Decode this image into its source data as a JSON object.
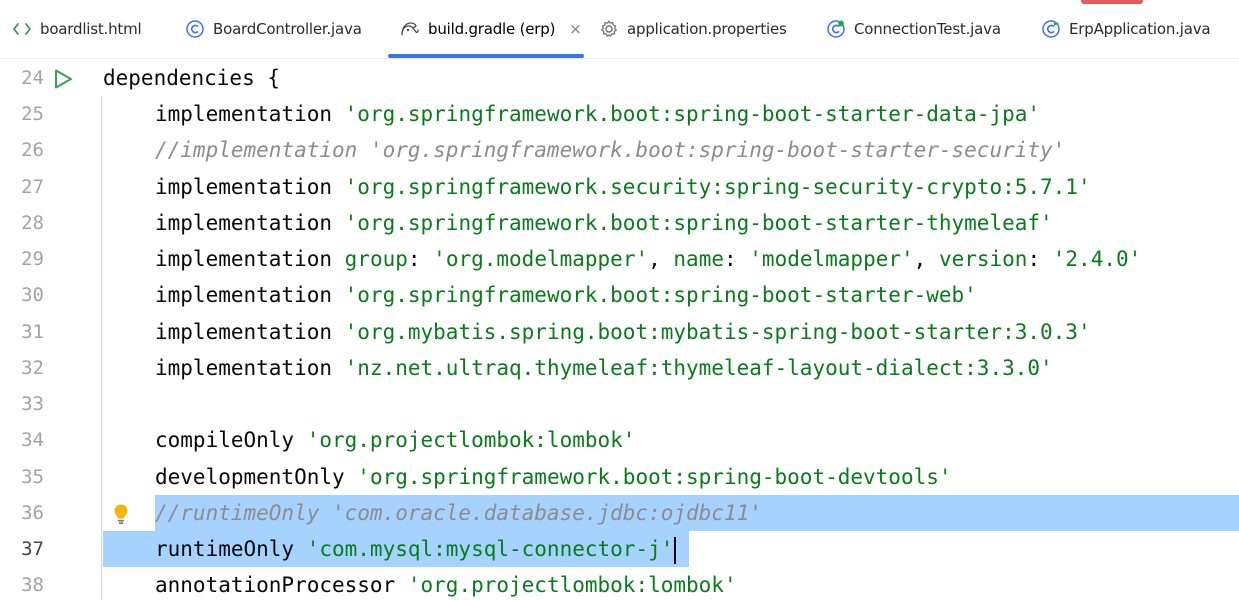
{
  "tabs": [
    {
      "label": "boardlist.html",
      "icon": "html-icon"
    },
    {
      "label": "BoardController.java",
      "icon": "java-class-icon"
    },
    {
      "label": "build.gradle (erp)",
      "icon": "gradle-icon",
      "active": true
    },
    {
      "label": "application.properties",
      "icon": "gear-icon"
    },
    {
      "label": "ConnectionTest.java",
      "icon": "java-test-icon"
    },
    {
      "label": "ErpApplication.java",
      "icon": "java-app-icon"
    }
  ],
  "tab_close_glyph": "×",
  "colors": {
    "accent": "#3574f0",
    "selection": "#a6d2ff",
    "string": "#067d17",
    "comment": "#8c8c8c",
    "run": "#2fa84f",
    "bulb": "#f2b705"
  },
  "editor": {
    "lines": [
      {
        "num": "24",
        "keyword": "dependencies {",
        "string": "",
        "comment": ""
      },
      {
        "num": "25",
        "keyword": "implementation ",
        "string": "'org.springframework.boot:spring-boot-starter-data-jpa'",
        "comment": ""
      },
      {
        "num": "26",
        "keyword": "",
        "string": "",
        "comment": "//implementation 'org.springframework.boot:spring-boot-starter-security'"
      },
      {
        "num": "27",
        "keyword": "implementation ",
        "string": "'org.springframework.security:spring-security-crypto:5.7.1'",
        "comment": ""
      },
      {
        "num": "28",
        "keyword": "implementation ",
        "string": "'org.springframework.boot:spring-boot-starter-thymeleaf'",
        "comment": ""
      },
      {
        "num": "29",
        "keyword": "implementation ",
        "group_label": "group",
        "group_value": "'org.modelmapper'",
        "name_label": "name",
        "name_value": "'modelmapper'",
        "version_label": "version",
        "version_value": "'2.4.0'"
      },
      {
        "num": "30",
        "keyword": "implementation ",
        "string": "'org.springframework.boot:spring-boot-starter-web'",
        "comment": ""
      },
      {
        "num": "31",
        "keyword": "implementation ",
        "string": "'org.mybatis.spring.boot:mybatis-spring-boot-starter:3.0.3'",
        "comment": ""
      },
      {
        "num": "32",
        "keyword": "implementation ",
        "string": "'nz.net.ultraq.thymeleaf:thymeleaf-layout-dialect:3.3.0'",
        "comment": ""
      },
      {
        "num": "33",
        "keyword": "",
        "string": "",
        "comment": ""
      },
      {
        "num": "34",
        "keyword": "compileOnly ",
        "string": "'org.projectlombok:lombok'",
        "comment": ""
      },
      {
        "num": "35",
        "keyword": "developmentOnly ",
        "string": "'org.springframework.boot:spring-boot-devtools'",
        "comment": ""
      },
      {
        "num": "36",
        "keyword": "",
        "string": "",
        "comment": "//runtimeOnly 'com.oracle.database.jdbc:ojdbc11'"
      },
      {
        "num": "37",
        "keyword": "runtimeOnly ",
        "string": "'com.mysql:mysql-connector-j'",
        "comment": ""
      },
      {
        "num": "38",
        "keyword": "annotationProcessor ",
        "string": "'org.projectlombok:lombok'",
        "comment": ""
      }
    ]
  }
}
